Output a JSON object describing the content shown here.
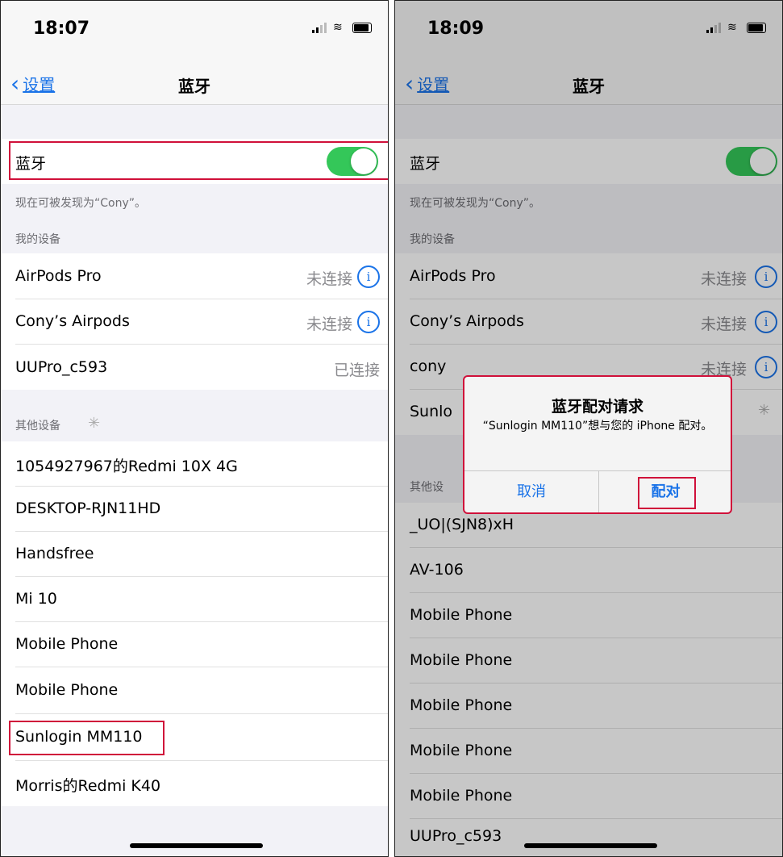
{
  "left": {
    "time": "18:07",
    "back_label": "设置",
    "title": "蓝牙",
    "bluetooth_label": "蓝牙",
    "discoverable_text": "现在可被发现为“Cony”。",
    "my_devices_header": "我的设备",
    "my_devices": [
      {
        "name": "AirPods Pro",
        "status": "未连接"
      },
      {
        "name": "Cony’s Airpods",
        "status": "未连接"
      },
      {
        "name": "UUPro_c593",
        "status": "已连接"
      }
    ],
    "other_devices_header": "其他设备",
    "other_devices": [
      "1054927967的Redmi 10X 4G",
      "DESKTOP-RJN11HD",
      "Handsfree",
      "Mi 10",
      "Mobile Phone",
      "Mobile Phone",
      "Sunlogin MM110",
      "Morris的Redmi K40"
    ]
  },
  "right": {
    "time": "18:09",
    "back_label": "设置",
    "title": "蓝牙",
    "bluetooth_label": "蓝牙",
    "discoverable_text": "现在可被发现为“Cony”。",
    "my_devices_header": "我的设备",
    "my_devices": [
      {
        "name": "AirPods Pro",
        "status": "未连接"
      },
      {
        "name": "Cony’s Airpods",
        "status": "未连接"
      },
      {
        "name": "cony",
        "status": "未连接"
      },
      {
        "name": "Sunlo"
      }
    ],
    "other_devices_header": "其他设",
    "other_devices": [
      "_UO|(SJN8)xH",
      "AV-106",
      "Mobile Phone",
      "Mobile Phone",
      "Mobile Phone",
      "Mobile Phone",
      "Mobile Phone",
      "UUPro_c593"
    ],
    "dialog": {
      "title": "蓝牙配对请求",
      "message": "“Sunlogin MM110”想与您的 iPhone 配对。",
      "cancel": "取消",
      "pair": "配对"
    }
  },
  "colors": {
    "accent": "#1a73e8",
    "toggle_on": "#34c759",
    "highlight": "#d0103a"
  }
}
